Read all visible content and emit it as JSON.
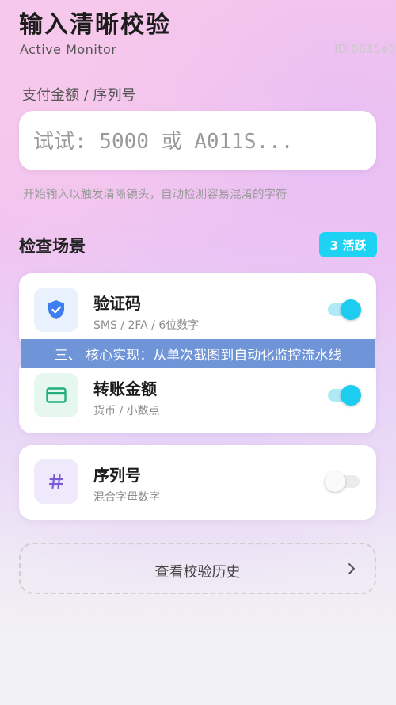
{
  "header": {
    "title": "输入清晰校验",
    "subtitle": "Active Monitor",
    "device_id": "ID:0615e0"
  },
  "input": {
    "label": "支付金额 / 序列号",
    "placeholder": "试试: 5000 或 A011S...",
    "value": "",
    "hint": "开始输入以触发清晰镜头，自动检测容易混淆的字符"
  },
  "scenes": {
    "title": "检查场景",
    "badge": "3 活跃",
    "items": [
      {
        "title": "验证码",
        "desc": "SMS / 2FA / 6位数字",
        "icon": "shield-check-icon",
        "enabled": true,
        "accent": "#3d7ff0"
      },
      {
        "title": "转账金额",
        "desc": "货币 / 小数点",
        "icon": "card-icon",
        "enabled": true,
        "accent": "#22b07a"
      },
      {
        "title": "序列号",
        "desc": "混合字母数字",
        "icon": "hash-icon",
        "enabled": false,
        "accent": "#7b5ad6"
      }
    ]
  },
  "banner": {
    "text": "三、 核心实现：从单次截图到自动化监控流水线"
  },
  "history": {
    "label": "查看校验历史"
  },
  "colors": {
    "accent": "#1dd2f2",
    "banner_bg": "#6f95d8"
  }
}
